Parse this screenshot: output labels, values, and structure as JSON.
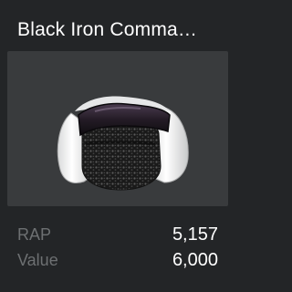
{
  "item": {
    "name": "Black Iron Comma…",
    "thumbnail_icon": "black-iron-commando-helmet-image"
  },
  "stats": [
    {
      "label": "RAP",
      "value": "5,157"
    },
    {
      "label": "Value",
      "value": "6,000"
    }
  ],
  "colors": {
    "card_background": "#232527",
    "thumbnail_background": "#393b3d",
    "label_text": "#6d7072",
    "value_text": "#ffffff"
  }
}
